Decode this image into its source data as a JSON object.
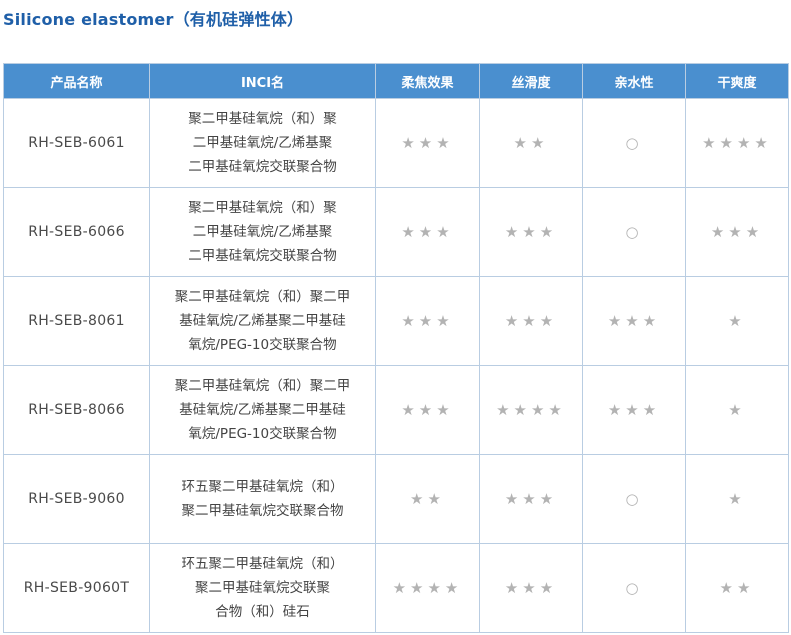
{
  "title": "Silicone elastomer（有机硅弹性体）",
  "columns": [
    "产品名称",
    "INCI名",
    "柔焦效果",
    "丝滑度",
    "亲水性",
    "干爽度"
  ],
  "rows": [
    {
      "product": "RH-SEB-6061",
      "inci": [
        "聚二甲基硅氧烷（和）聚",
        "二甲基硅氧烷/乙烯基聚",
        "二甲基硅氧烷交联聚合物"
      ],
      "soft_focus": "★★★",
      "silkiness": "★★",
      "hydrophilicity": "○",
      "dryness": "★★★★"
    },
    {
      "product": "RH-SEB-6066",
      "inci": [
        "聚二甲基硅氧烷（和）聚",
        "二甲基硅氧烷/乙烯基聚",
        "二甲基硅氧烷交联聚合物"
      ],
      "soft_focus": "★★★",
      "silkiness": "★★★",
      "hydrophilicity": "○",
      "dryness": "★★★"
    },
    {
      "product": "RH-SEB-8061",
      "inci": [
        "聚二甲基硅氧烷（和）聚二甲",
        "基硅氧烷/乙烯基聚二甲基硅",
        "氧烷/PEG-10交联聚合物"
      ],
      "soft_focus": "★★★",
      "silkiness": "★★★",
      "hydrophilicity": "★★★",
      "dryness": "★"
    },
    {
      "product": "RH-SEB-8066",
      "inci": [
        "聚二甲基硅氧烷（和）聚二甲",
        "基硅氧烷/乙烯基聚二甲基硅",
        "氧烷/PEG-10交联聚合物"
      ],
      "soft_focus": "★★★",
      "silkiness": "★★★★",
      "hydrophilicity": "★★★",
      "dryness": "★"
    },
    {
      "product": "RH-SEB-9060",
      "inci": [
        "环五聚二甲基硅氧烷（和）",
        "聚二甲基硅氧烷交联聚合物"
      ],
      "soft_focus": "★★",
      "silkiness": "★★★",
      "hydrophilicity": "○",
      "dryness": "★"
    },
    {
      "product": "RH-SEB-9060T",
      "inci": [
        "环五聚二甲基硅氧烷（和）",
        "聚二甲基硅氧烷交联聚",
        "合物（和）硅石"
      ],
      "soft_focus": "★★★★",
      "silkiness": "★★★",
      "hydrophilicity": "○",
      "dryness": "★★"
    }
  ]
}
